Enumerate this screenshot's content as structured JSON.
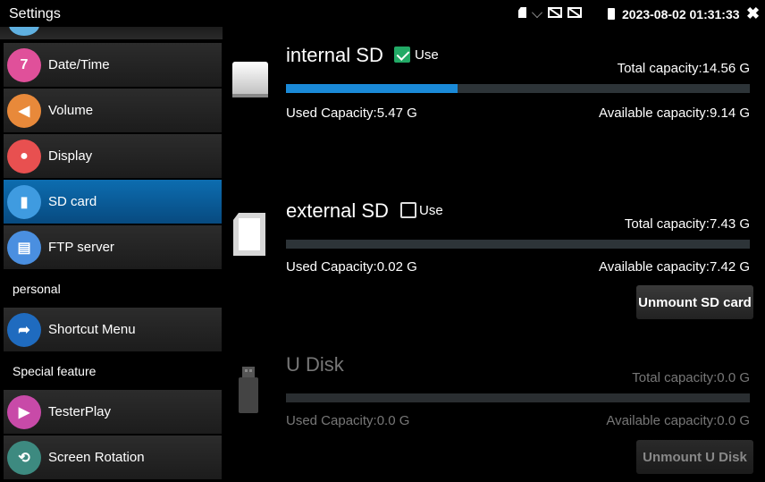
{
  "statusbar": {
    "title": "Settings",
    "datetime": "2023-08-02 01:31:33",
    "close_glyph": "✖",
    "icons": [
      "sd-card-icon",
      "heart-icon",
      "screen-off-icon",
      "screen-off-icon",
      "battery-icon"
    ]
  },
  "sidebar": {
    "items": [
      {
        "label": "Date/Time",
        "icon": "calendar-icon",
        "color": "#e0509a"
      },
      {
        "label": "Volume",
        "icon": "speaker-icon",
        "color": "#e8893a"
      },
      {
        "label": "Display",
        "icon": "lightbulb-icon",
        "color": "#e85050"
      },
      {
        "label": "SD card",
        "icon": "sd-card-icon",
        "color": "#3f9be0"
      },
      {
        "label": "FTP server",
        "icon": "ftp-server-icon",
        "color": "#4a8fe0"
      }
    ],
    "section_personal": "personal",
    "personal_items": [
      {
        "label": "Shortcut Menu",
        "icon": "shortcut-icon",
        "color": "#1f6bbf"
      }
    ],
    "section_special": "Special feature",
    "special_items": [
      {
        "label": "TesterPlay",
        "icon": "play-icon",
        "color": "#c84aa8"
      },
      {
        "label": "Screen Rotation",
        "icon": "rotate-icon",
        "color": "#3d8a80"
      }
    ]
  },
  "internal_sd": {
    "title": "internal SD",
    "use_label": "Use",
    "use_checked": true,
    "total": "Total capacity:14.56 G",
    "used": "Used Capacity:5.47 G",
    "available": "Available capacity:9.14 G",
    "usage_fraction": 0.37
  },
  "external_sd": {
    "title": "external SD",
    "use_label": "Use",
    "use_checked": false,
    "total": "Total capacity:7.43 G",
    "used": "Used Capacity:0.02 G",
    "available": "Available capacity:7.42 G",
    "usage_fraction": 0.0,
    "button": "Unmount SD card"
  },
  "u_disk": {
    "title": "U Disk",
    "total": "Total capacity:0.0 G",
    "used": "Used Capacity:0.0 G",
    "available": "Available capacity:0.0 G",
    "usage_fraction": 0.0,
    "button": "Unmount U Disk"
  },
  "colors": {
    "accent": "#1a8ad8",
    "active_item": "#0b63a5",
    "checkbox_on": "#22aa66"
  }
}
